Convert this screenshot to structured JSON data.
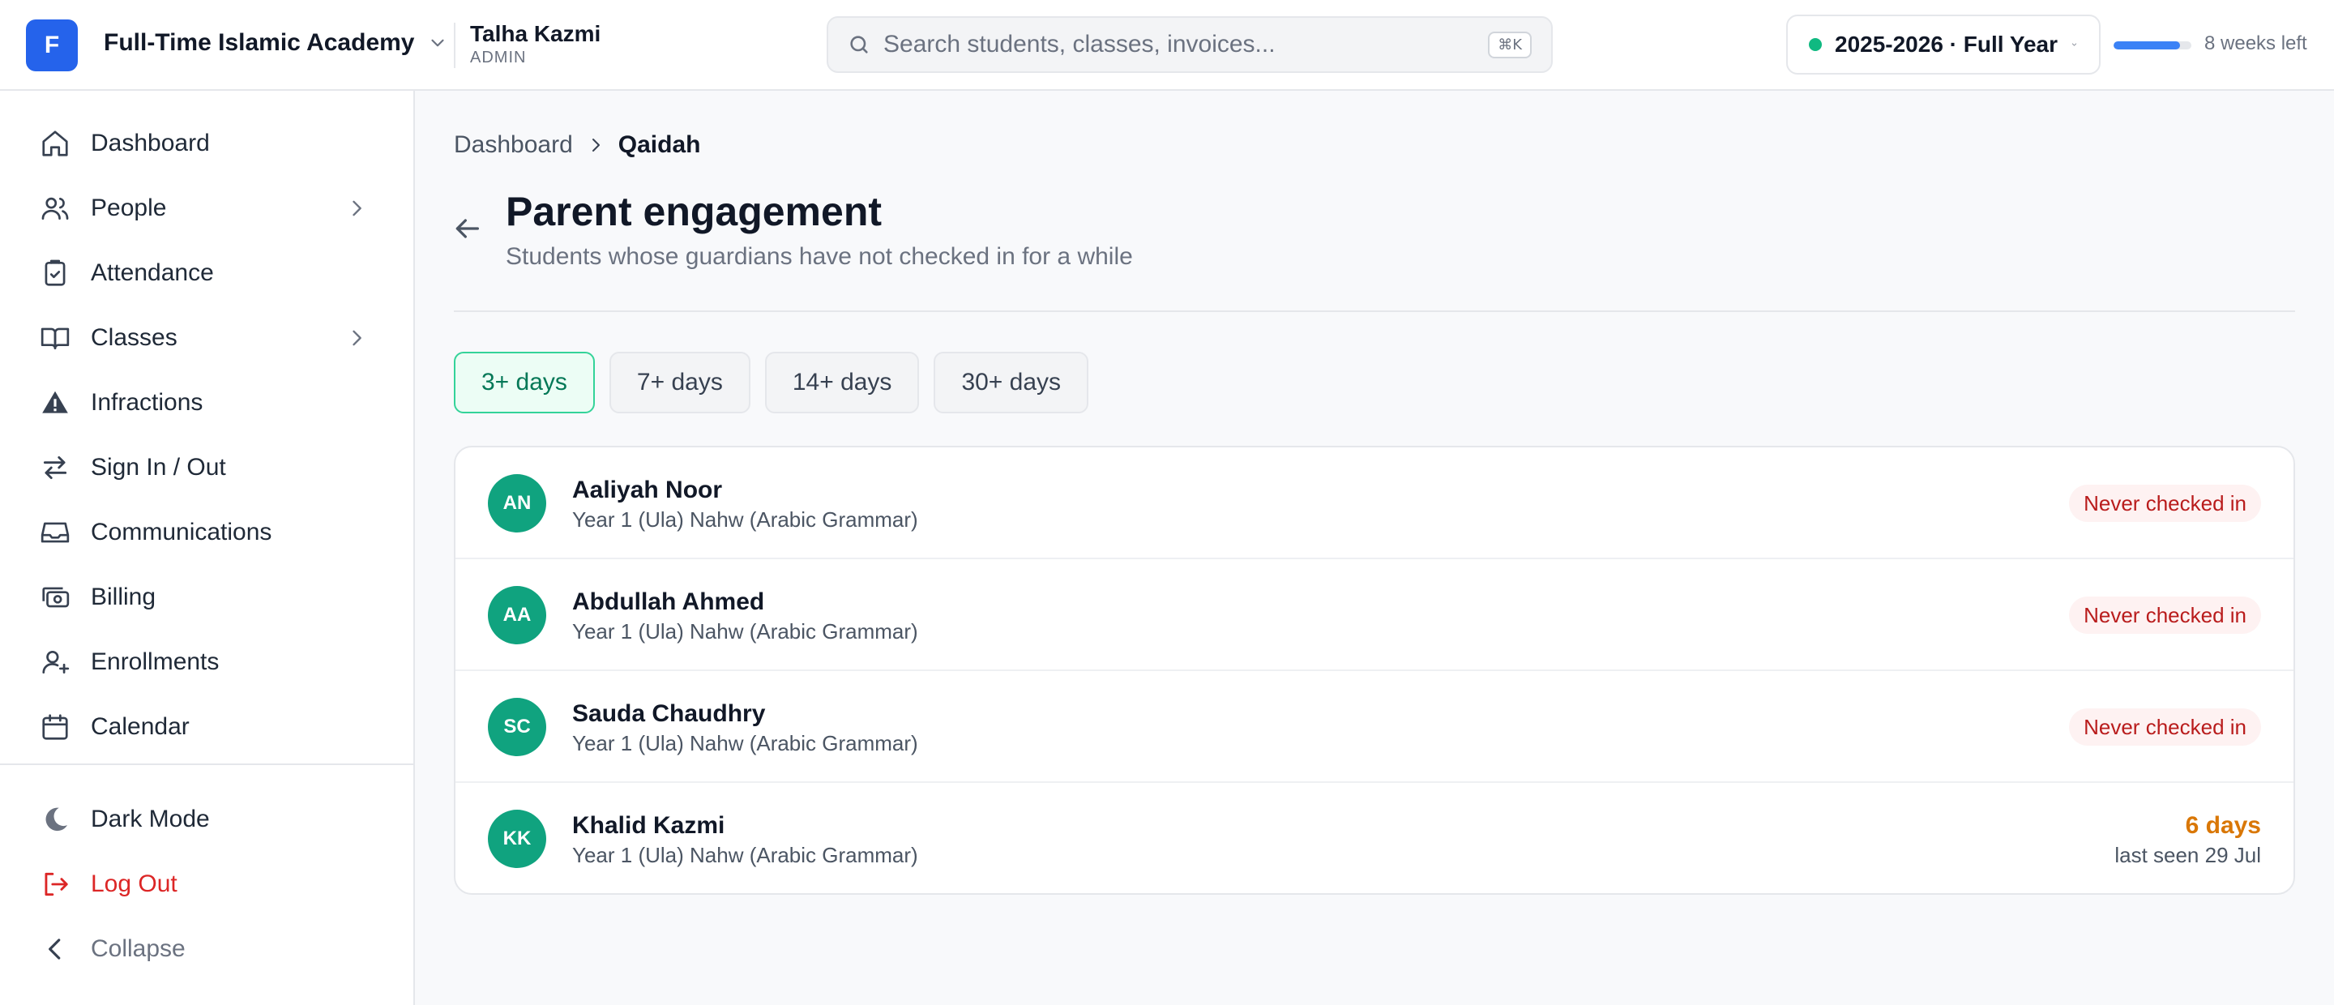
{
  "colors": {
    "brand": "#2563eb",
    "accent_green": "#10b981",
    "avatar_bg": "#10a37f",
    "danger": "#dc2626",
    "warning": "#d97706",
    "active_filter": "#047857"
  },
  "topbar": {
    "logo_letter": "F",
    "org_name": "Full-Time Islamic Academy",
    "user_name": "Talha Kazmi",
    "user_role": "ADMIN",
    "search_placeholder": "Search students, classes, invoices...",
    "search_shortcut": "⌘K",
    "academic_year": "2025-2026 · Full Year",
    "year_progress_fraction": 0.85,
    "weeks_left": "8 weeks left"
  },
  "sidebar": {
    "items": [
      {
        "label": "Dashboard",
        "icon": "home-icon",
        "has_submenu": false
      },
      {
        "label": "People",
        "icon": "users-icon",
        "has_submenu": true
      },
      {
        "label": "Attendance",
        "icon": "clipboard-check-icon",
        "has_submenu": false
      },
      {
        "label": "Classes",
        "icon": "book-open-icon",
        "has_submenu": true
      },
      {
        "label": "Infractions",
        "icon": "warning-icon",
        "has_submenu": false
      },
      {
        "label": "Sign In / Out",
        "icon": "arrows-swap-icon",
        "has_submenu": false
      },
      {
        "label": "Communications",
        "icon": "inbox-icon",
        "has_submenu": false
      },
      {
        "label": "Billing",
        "icon": "cash-icon",
        "has_submenu": false
      },
      {
        "label": "Enrollments",
        "icon": "user-plus-icon",
        "has_submenu": false
      },
      {
        "label": "Calendar",
        "icon": "calendar-icon",
        "has_submenu": false
      }
    ],
    "footer": {
      "dark_mode": "Dark Mode",
      "logout": "Log Out",
      "collapse": "Collapse"
    }
  },
  "main": {
    "breadcrumb": [
      "Dashboard",
      "Qaidah"
    ],
    "title": "Parent engagement",
    "subtitle": "Students whose guardians have not checked in for a while",
    "filters": [
      {
        "label": "3+ days",
        "active": true
      },
      {
        "label": "7+ days",
        "active": false
      },
      {
        "label": "14+ days",
        "active": false
      },
      {
        "label": "30+ days",
        "active": false
      }
    ],
    "students": [
      {
        "initials": "AN",
        "name": "Aaliyah Noor",
        "class": "Year 1 (Ula) Nahw (Arabic Grammar)",
        "status": "Never checked in"
      },
      {
        "initials": "AA",
        "name": "Abdullah Ahmed",
        "class": "Year 1 (Ula) Nahw (Arabic Grammar)",
        "status": "Never checked in"
      },
      {
        "initials": "SC",
        "name": "Sauda Chaudhry",
        "class": "Year 1 (Ula) Nahw (Arabic Grammar)",
        "status": "Never checked in"
      },
      {
        "initials": "KK",
        "name": "Khalid Kazmi",
        "class": "Year 1 (Ula) Nahw (Arabic Grammar)",
        "days": "6 days",
        "last_seen": "last seen 29 Jul"
      }
    ]
  }
}
